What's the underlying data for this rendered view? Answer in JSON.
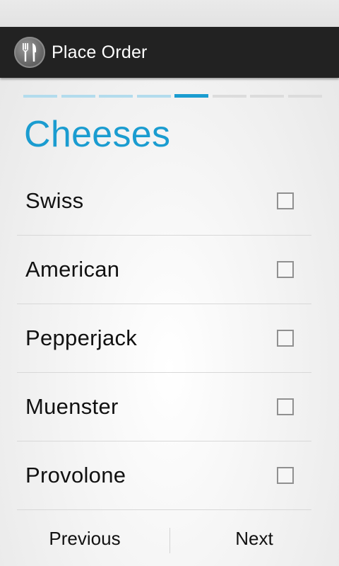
{
  "app": {
    "title": "Place Order"
  },
  "wizard": {
    "total_steps": 8,
    "current_step": 5,
    "colors": {
      "done": "#b3dced",
      "current": "#1a9cd0",
      "upcoming": "#dcdcdc"
    }
  },
  "page": {
    "title": "Cheeses"
  },
  "options": [
    {
      "label": "Swiss",
      "checked": false
    },
    {
      "label": "American",
      "checked": false
    },
    {
      "label": "Pepperjack",
      "checked": false
    },
    {
      "label": "Muenster",
      "checked": false
    },
    {
      "label": "Provolone",
      "checked": false
    }
  ],
  "nav": {
    "previous_label": "Previous",
    "next_label": "Next"
  },
  "icons": {
    "app": "fork-knife-icon"
  }
}
